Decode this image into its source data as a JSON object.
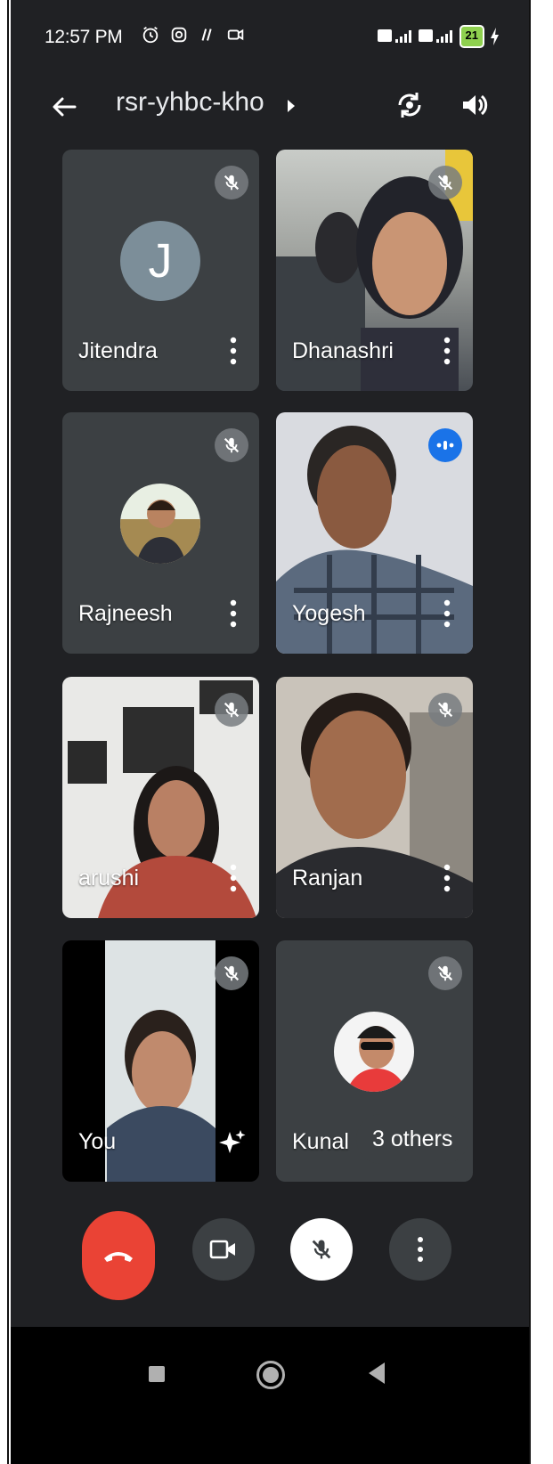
{
  "status_bar": {
    "time": "12:57 PM",
    "battery": "21"
  },
  "top_bar": {
    "meeting_code": "rsr-yhbc-kho"
  },
  "participants": [
    {
      "name": "Jitendra",
      "avatar_letter": "J",
      "muted": true
    },
    {
      "name": "Dhanashri",
      "muted": true
    },
    {
      "name": "Rajneesh",
      "muted": true
    },
    {
      "name": "Yogesh",
      "speaking": true
    },
    {
      "name": "arushi",
      "muted": true
    },
    {
      "name": "Ranjan",
      "muted": true
    },
    {
      "name": "You",
      "muted": true
    },
    {
      "name": "Kunal",
      "muted": true
    }
  ],
  "others_chip": "3 others",
  "colors": {
    "background": "#202124",
    "tile": "#3c4043",
    "end_call": "#ea4335",
    "speaking": "#1a73e8"
  },
  "icons": [
    "back-arrow-icon",
    "switch-camera-icon",
    "speaker-icon",
    "mic-off-icon",
    "more-vert-icon",
    "speaking-indicator-icon",
    "sparkle-effects-icon",
    "end-call-icon",
    "camera-icon"
  ]
}
